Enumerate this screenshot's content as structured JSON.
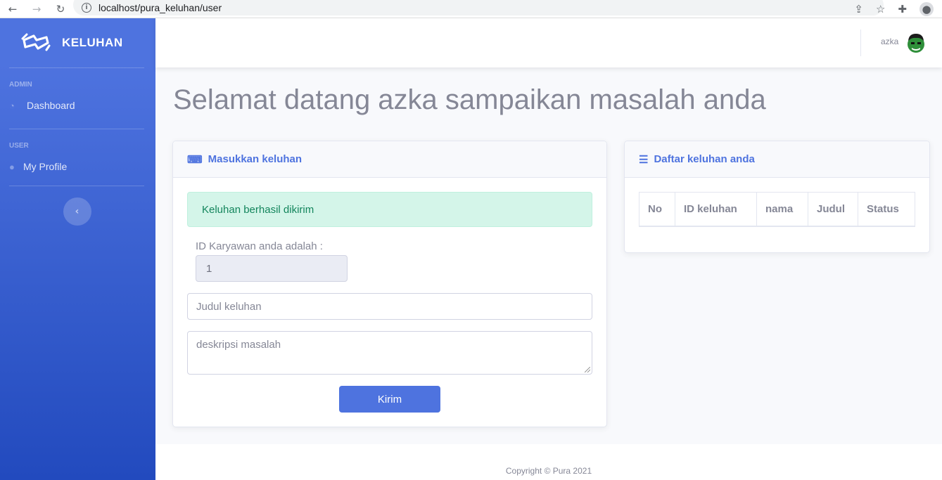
{
  "browser": {
    "url": "localhost/pura_keluhan/user",
    "back_icon": "arrow-left-icon",
    "forward_icon": "arrow-right-icon",
    "reload_icon": "reload-icon"
  },
  "sidebar": {
    "brand": "KELUHAN",
    "sections": [
      {
        "heading": "ADMIN",
        "items": [
          {
            "label": "Dashboard",
            "icon": "tachometer-icon"
          }
        ]
      },
      {
        "heading": "USER",
        "items": [
          {
            "label": "My Profile",
            "icon": "user-icon"
          }
        ]
      }
    ],
    "toggle_icon": "chevron-left-icon",
    "gradient": [
      "#4e73df",
      "#224abe"
    ]
  },
  "topbar": {
    "user_name": "azka"
  },
  "main": {
    "title": "Selamat datang azka sampaikan masalah anda",
    "form_card": {
      "header": "Masukkan keluhan",
      "header_icon": "keyboard-icon",
      "alert": "Keluhan berhasil dikirim",
      "id_label": "ID Karyawan anda adalah :",
      "id_value": "1",
      "judul_placeholder": "Judul keluhan",
      "deskripsi_placeholder": "deskripsi masalah",
      "submit_label": "Kirim"
    },
    "list_card": {
      "header": "Daftar keluhan anda",
      "header_icon": "list-icon",
      "columns": [
        "No",
        "ID keluhan",
        "nama",
        "Judul",
        "Status"
      ]
    }
  },
  "footer": {
    "copyright": "Copyright © Pura 2021"
  },
  "colors": {
    "primary": "#4e73df",
    "success_bg": "#d4f5e9",
    "success_text": "#13855c",
    "text_muted": "#858796"
  }
}
